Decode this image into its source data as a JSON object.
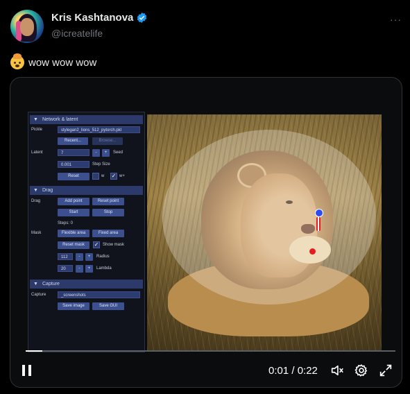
{
  "author": {
    "name": "Kris Kashtanova",
    "handle": "@icreatelife"
  },
  "menu_label": "···",
  "tweet_text": "wow wow wow",
  "emoji": "exploding-head-icon",
  "gui": {
    "sections": {
      "network": "Network & latent",
      "drag": "Drag",
      "capture": "Capture"
    },
    "pickle_label": "Pickle",
    "pickle_value": "stylegan2_lions_512_pytorch.pkl",
    "recent_button": "Recent...",
    "browse_button": "Browse...",
    "latent_label": "Latent",
    "seed_value": "7",
    "seed_minus": "-",
    "seed_plus": "+",
    "seed_label": "Seed",
    "step_value": "0.001",
    "step_label": "Step Size",
    "reset_button": "Reset",
    "w_label": "w",
    "wplus_label": "w+",
    "drag_label": "Drag",
    "add_point_button": "Add point",
    "reset_point_button": "Reset point",
    "start_button": "Start",
    "stop_button": "Stop",
    "steps_text": "Steps: 0",
    "mask_label": "Mask",
    "flexible_area_button": "Flexible area",
    "fixed_area_button": "Fixed area",
    "reset_mask_button": "Reset mask",
    "show_mask_label": "Show mask",
    "radius_value": "112",
    "radius_label": "Radius",
    "lambda_value": "20",
    "lambda_label": "Lambda",
    "capture_label": "Capture",
    "capture_value": "_screenshots",
    "save_image_button": "Save image",
    "save_gui_button": "Save GUI"
  },
  "video": {
    "time": "0:01 / 0:22",
    "progress_fraction": 0.045
  },
  "colors": {
    "accent_blue": "#1d9bf0",
    "background": "#000000",
    "handle_gray": "#71767b"
  }
}
